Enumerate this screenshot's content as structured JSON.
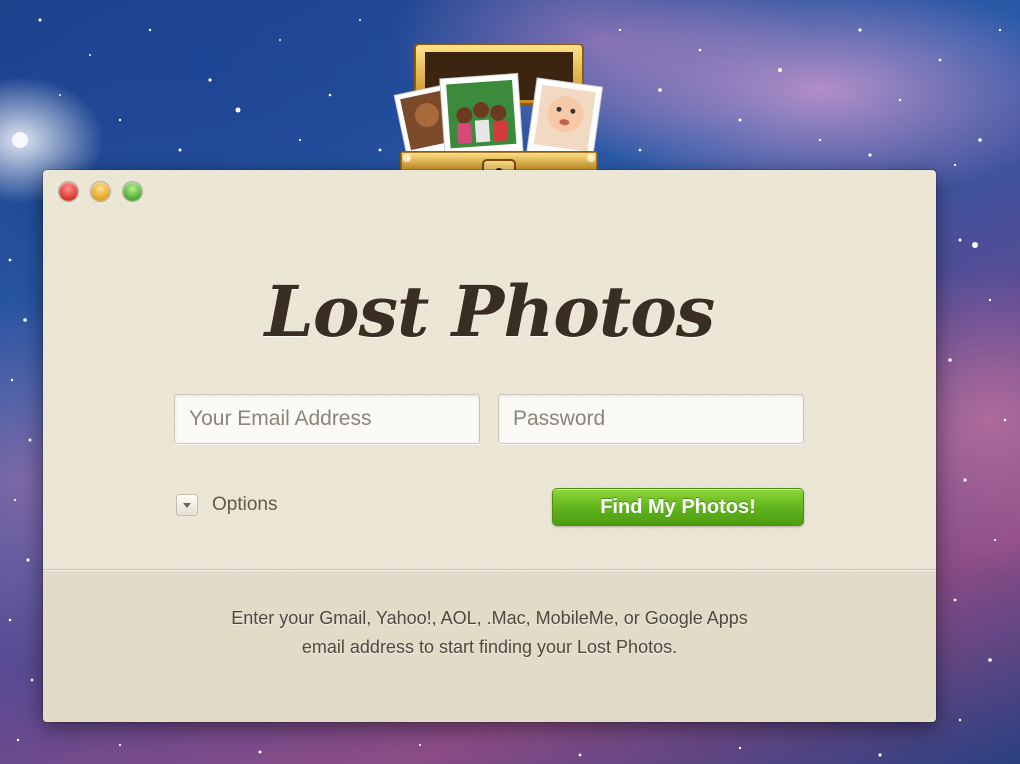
{
  "window": {
    "controls": [
      "close",
      "minimize",
      "zoom"
    ]
  },
  "app": {
    "title": "Lost Photos",
    "logo_icon": "treasure-chest-with-photos-icon"
  },
  "form": {
    "email_placeholder": "Your Email Address",
    "password_placeholder": "Password",
    "options_label": "Options",
    "submit_label": "Find My Photos!"
  },
  "footer": {
    "line1": "Enter your Gmail, Yahoo!, AOL, .Mac, MobileMe, or Google Apps",
    "line2": "email address to start finding your Lost Photos."
  },
  "colors": {
    "window_bg": "#ede7d6",
    "footer_bg": "#e2dbc7",
    "accent_green": "#5fb11c",
    "title_brown": "#3a2e24"
  }
}
